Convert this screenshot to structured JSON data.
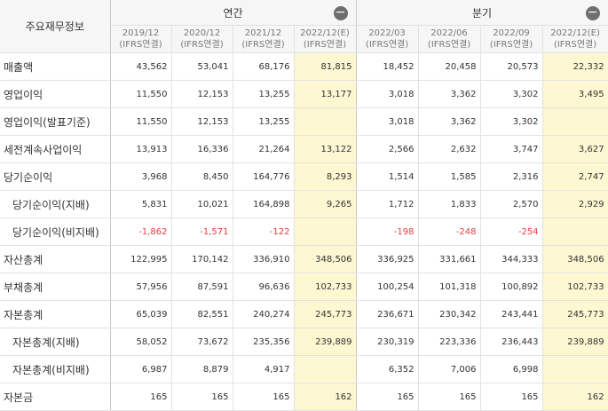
{
  "header": {
    "item_label": "주요재무정보",
    "annual_label": "연간",
    "quarterly_label": "분기",
    "collapse_icon": "minus-circle-icon",
    "annual_columns": [
      {
        "period": "2019/12",
        "basis": "(IFRS연결)"
      },
      {
        "period": "2020/12",
        "basis": "(IFRS연결)"
      },
      {
        "period": "2021/12",
        "basis": "(IFRS연결)"
      },
      {
        "period": "2022/12(E)",
        "basis": "(IFRS연결)"
      }
    ],
    "quarterly_columns": [
      {
        "period": "2022/03",
        "basis": "(IFRS연결)"
      },
      {
        "period": "2022/06",
        "basis": "(IFRS연결)"
      },
      {
        "period": "2022/09",
        "basis": "(IFRS연결)"
      },
      {
        "period": "2022/12(E)",
        "basis": "(IFRS연결)"
      }
    ]
  },
  "colors": {
    "estimate_bg": "#fdf7d2",
    "negative": "#e04040"
  },
  "rows": [
    {
      "label": "매출액",
      "values": [
        "43,562",
        "53,041",
        "68,176",
        "81,815",
        "18,452",
        "20,458",
        "20,573",
        "22,332"
      ]
    },
    {
      "label": "영업이익",
      "values": [
        "11,550",
        "12,153",
        "13,255",
        "13,177",
        "3,018",
        "3,362",
        "3,302",
        "3,495"
      ]
    },
    {
      "label": "영업이익(발표기준)",
      "values": [
        "11,550",
        "12,153",
        "13,255",
        "",
        "3,018",
        "3,362",
        "3,302",
        ""
      ]
    },
    {
      "label": "세전계속사업이익",
      "values": [
        "13,913",
        "16,336",
        "21,264",
        "13,122",
        "2,566",
        "2,632",
        "3,747",
        "3,627"
      ]
    },
    {
      "label": "당기순이익",
      "values": [
        "3,968",
        "8,450",
        "164,776",
        "8,293",
        "1,514",
        "1,585",
        "2,316",
        "2,747"
      ]
    },
    {
      "label": "당기순이익(지배)",
      "values": [
        "5,831",
        "10,021",
        "164,898",
        "9,265",
        "1,712",
        "1,833",
        "2,570",
        "2,929"
      ]
    },
    {
      "label": "당기순이익(비지배)",
      "values": [
        "-1,862",
        "-1,571",
        "-122",
        "",
        "-198",
        "-248",
        "-254",
        ""
      ]
    },
    {
      "label": "자산총계",
      "values": [
        "122,995",
        "170,142",
        "336,910",
        "348,506",
        "336,925",
        "331,661",
        "344,333",
        "348,506"
      ]
    },
    {
      "label": "부채총계",
      "values": [
        "57,956",
        "87,591",
        "96,636",
        "102,733",
        "100,254",
        "101,318",
        "100,892",
        "102,733"
      ]
    },
    {
      "label": "자본총계",
      "values": [
        "65,039",
        "82,551",
        "240,274",
        "245,773",
        "236,671",
        "230,342",
        "243,441",
        "245,773"
      ]
    },
    {
      "label": "자본총계(지배)",
      "values": [
        "58,052",
        "73,672",
        "235,356",
        "239,889",
        "230,319",
        "223,336",
        "236,443",
        "239,889"
      ]
    },
    {
      "label": "자본총계(비지배)",
      "values": [
        "6,987",
        "8,879",
        "4,917",
        "",
        "6,352",
        "7,006",
        "6,998",
        ""
      ]
    },
    {
      "label": "자본금",
      "values": [
        "165",
        "165",
        "165",
        "162",
        "165",
        "165",
        "165",
        "162"
      ]
    }
  ]
}
